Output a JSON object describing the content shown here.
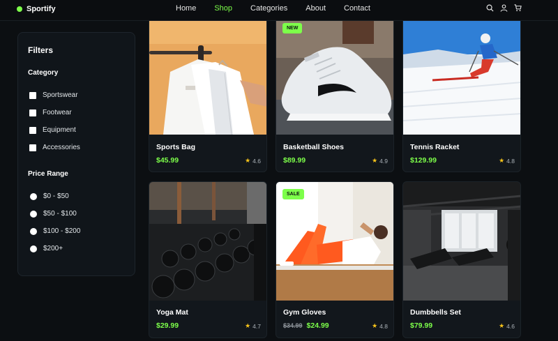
{
  "brand": {
    "name": "Sportify"
  },
  "nav": {
    "links": [
      {
        "label": "Home"
      },
      {
        "label": "Shop",
        "active": true
      },
      {
        "label": "Categories"
      },
      {
        "label": "About"
      },
      {
        "label": "Contact"
      }
    ],
    "icons": [
      "search-icon",
      "user-icon",
      "cart-icon"
    ]
  },
  "sidebar": {
    "title": "Filters",
    "category_title": "Category",
    "categories": [
      "Sportswear",
      "Footwear",
      "Equipment",
      "Accessories"
    ],
    "price_title": "Price Range",
    "prices": [
      "$0 - $50",
      "$50 - $100",
      "$100 - $200",
      "$200+"
    ]
  },
  "products": [
    {
      "name": "Sports Bag",
      "price": "$45.99",
      "rating": "4.6",
      "image": "shirts-on-rack"
    },
    {
      "name": "Basketball Shoes",
      "price": "$89.99",
      "rating": "4.9",
      "badge": "NEW",
      "image": "sneaker"
    },
    {
      "name": "Tennis Racket",
      "price": "$129.99",
      "rating": "4.8",
      "image": "skier"
    },
    {
      "name": "Yoga Mat",
      "price": "$29.99",
      "rating": "4.7",
      "image": "dumbbell-rack"
    },
    {
      "name": "Gym Gloves",
      "old_price": "$34.99",
      "price": "$24.99",
      "rating": "4.8",
      "badge": "SALE",
      "image": "woman-doing-situps"
    },
    {
      "name": "Dumbbells Set",
      "price": "$79.99",
      "rating": "4.6",
      "image": "gym-interior"
    }
  ],
  "colors": {
    "accent": "#7dff4a",
    "background": "#0c0f12",
    "star": "#f7c31a"
  }
}
